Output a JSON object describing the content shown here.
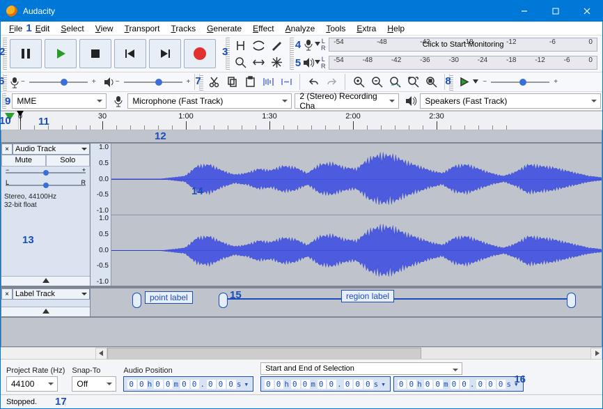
{
  "title": "Audacity",
  "menus": [
    "File",
    "Edit",
    "Select",
    "View",
    "Transport",
    "Tracks",
    "Generate",
    "Effect",
    "Analyze",
    "Tools",
    "Extra",
    "Help"
  ],
  "annotations": {
    "1": "1",
    "2": "2",
    "3": "3",
    "4": "4",
    "5": "5",
    "6": "6",
    "7": "7",
    "8": "8",
    "9": "9",
    "10": "10",
    "11": "11",
    "12": "12",
    "13": "13",
    "14": "14",
    "15": "15",
    "16": "16",
    "17": "17"
  },
  "meters": {
    "ticks": [
      "-54",
      "-48",
      "-42",
      "-36",
      "-30",
      "-24",
      "-18",
      "-12",
      "-6",
      "0"
    ],
    "rec_ticks_visible": [
      "-54",
      "-48",
      "-42",
      "-18",
      "-12",
      "-6",
      "0"
    ],
    "click_text": "Click to Start Monitoring"
  },
  "device": {
    "host": "MME",
    "rec_dev": "Microphone (Fast Track)",
    "rec_ch": "2 (Stereo) Recording Cha",
    "play_dev": "Speakers (Fast Track)"
  },
  "timeline": {
    "labels": [
      "0",
      "30",
      "1:00",
      "1:30",
      "2:00",
      "2:30"
    ]
  },
  "track": {
    "name": "Audio Track",
    "mute": "Mute",
    "solo": "Solo",
    "info1": "Stereo, 44100Hz",
    "info2": "32-bit float",
    "vscale": [
      "1.0",
      "0.5",
      "0.0",
      "-0.5",
      "-1.0"
    ]
  },
  "label_track": {
    "name": "Label Track",
    "point_label": "point label",
    "region_label": "region label"
  },
  "selection": {
    "rate_label": "Project Rate (Hz)",
    "rate_value": "44100",
    "snap_label": "Snap-To",
    "snap_value": "Off",
    "pos_label": "Audio Position",
    "sel_label": "Start and End of Selection",
    "time_zero": "00 h 00 m 00.000 s"
  },
  "status": "Stopped."
}
